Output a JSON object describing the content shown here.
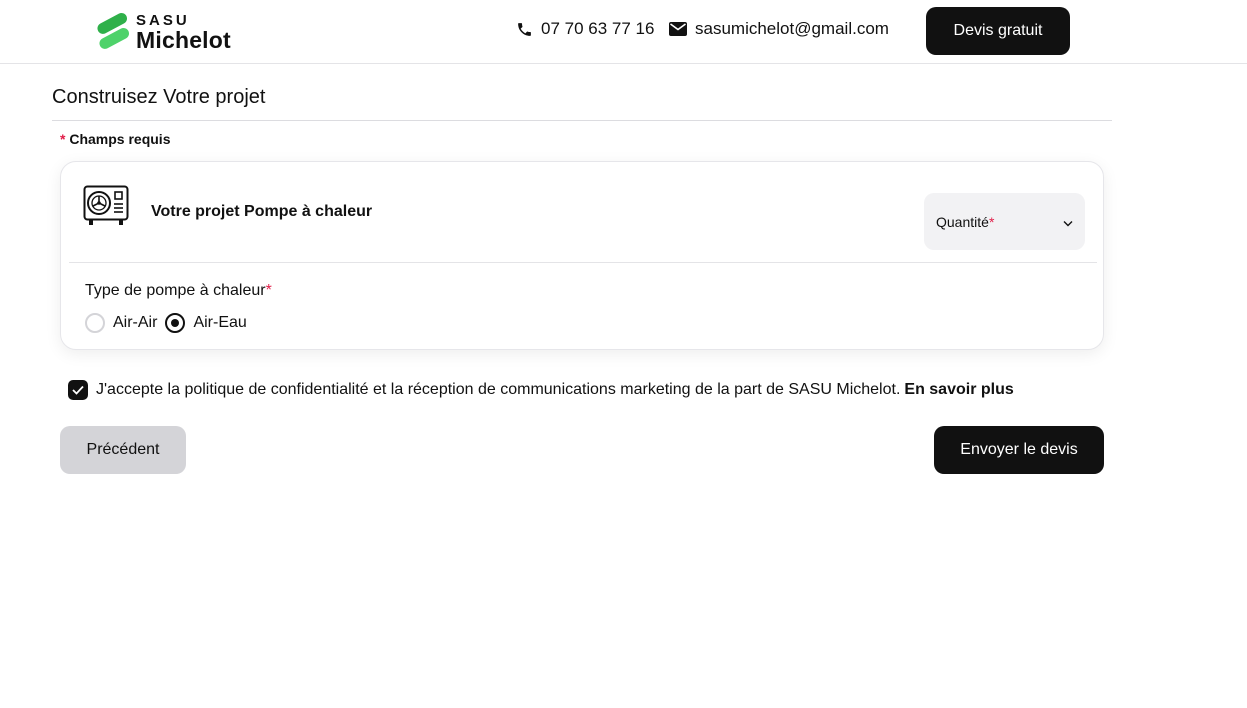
{
  "header": {
    "logo_small": "SASU",
    "logo_big": "Michelot",
    "phone": "07 70 63 77 16",
    "email": "sasumichelot@gmail.com",
    "cta_label": "Devis gratuit"
  },
  "page": {
    "title": "Construisez Votre projet",
    "required_star": "*",
    "required_note": "Champs requis"
  },
  "card": {
    "icon": "heat-pump-icon",
    "title": "Votre projet Pompe à chaleur",
    "quantity_label": "Quantité",
    "quantity_star": "*",
    "type_label": "Type de pompe à chaleur",
    "type_star": "*",
    "options": [
      {
        "label": "Air-Air",
        "selected": false
      },
      {
        "label": "Air-Eau",
        "selected": true
      }
    ]
  },
  "consent": {
    "checked": true,
    "text": "J'accepte la politique de confidentialité et la réception de communications marketing de la part de SASU Michelot.",
    "link": "En savoir plus"
  },
  "actions": {
    "previous_label": "Précédent",
    "submit_label": "Envoyer le devis"
  },
  "colors": {
    "brand_green": "#3cc85a",
    "required_red": "#e11d48",
    "button_dark": "#111111",
    "button_secondary": "#d4d4d8"
  }
}
